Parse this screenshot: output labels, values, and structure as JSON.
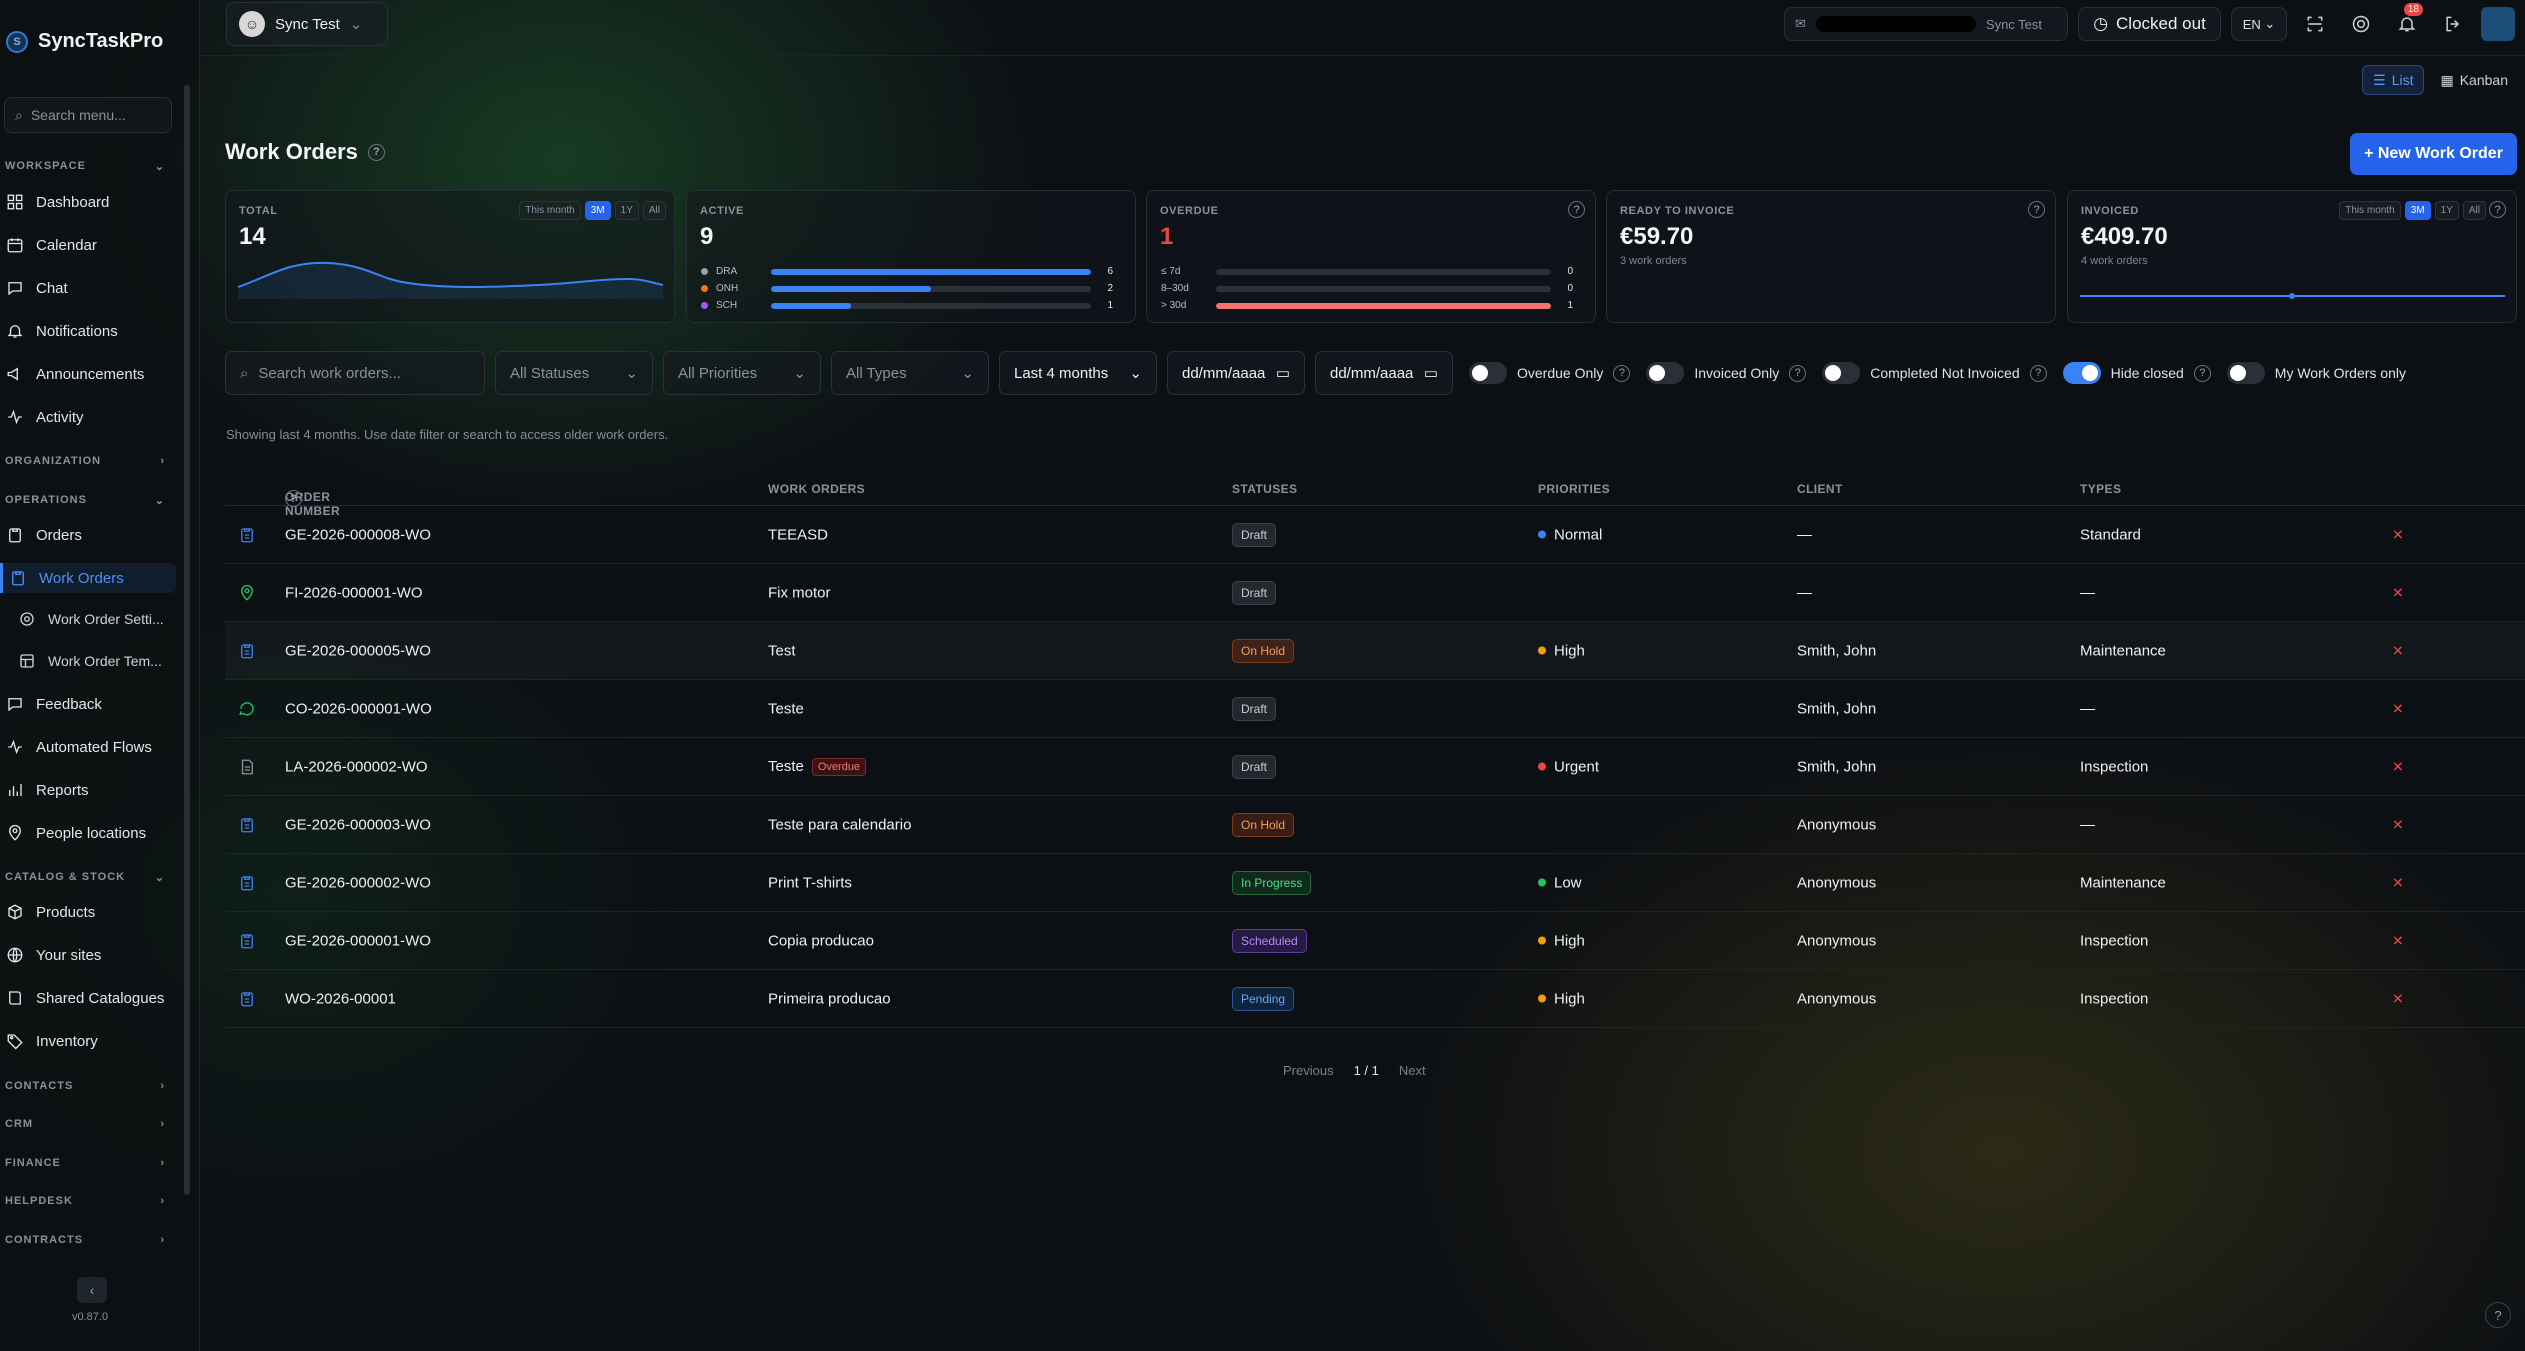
{
  "app": {
    "name": "SyncTaskPro",
    "version": "v0.87.0",
    "logo_letter": "S"
  },
  "sidebar": {
    "search_placeholder": "Search menu...",
    "sections": {
      "workspace": "WORKSPACE",
      "organization": "ORGANIZATION",
      "operations": "OPERATIONS",
      "catalog": "CATALOG & STOCK",
      "contacts": "CONTACTS",
      "crm": "CRM",
      "finance": "FINANCE",
      "helpdesk": "HELPDESK",
      "contracts": "CONTRACTS"
    },
    "items": {
      "dashboard": "Dashboard",
      "calendar": "Calendar",
      "chat": "Chat",
      "notifications": "Notifications",
      "announcements": "Announcements",
      "activity": "Activity",
      "orders": "Orders",
      "work_orders": "Work Orders",
      "wo_settings": "Work Order Setti...",
      "wo_templates": "Work Order Tem...",
      "feedback": "Feedback",
      "automated_flows": "Automated Flows",
      "reports": "Reports",
      "people_locations": "People locations",
      "products": "Products",
      "your_sites": "Your sites",
      "shared_catalogues": "Shared Catalogues",
      "inventory": "Inventory"
    }
  },
  "topbar": {
    "user": "Sync Test",
    "email_suffix": "Sync Test",
    "clock_status": "Clocked out",
    "language": "EN",
    "notification_count": "18"
  },
  "view": {
    "list": "List",
    "kanban": "Kanban",
    "active": "list"
  },
  "page": {
    "title": "Work Orders",
    "new_button": "+ New Work Order",
    "hint": "Showing last 4 months. Use date filter or search to access older work orders."
  },
  "cards": {
    "total": {
      "label": "TOTAL",
      "value": "14",
      "periods": [
        "This month",
        "3M",
        "1Y",
        "All"
      ],
      "active_period": "3M"
    },
    "active": {
      "label": "ACTIVE",
      "value": "9",
      "rows": [
        {
          "label": "DRA",
          "count": "6",
          "fraction": 1.0,
          "color": "#3b82f6",
          "dot": "#9aa1aa"
        },
        {
          "label": "ONH",
          "count": "2",
          "fraction": 0.5,
          "color": "#3b82f6",
          "dot": "#f97316"
        },
        {
          "label": "SCH",
          "count": "1",
          "fraction": 0.25,
          "color": "#3b82f6",
          "dot": "#a855f7"
        }
      ]
    },
    "overdue": {
      "label": "OVERDUE",
      "value": "1",
      "rows": [
        {
          "label": "≤ 7d",
          "count": "0",
          "fraction": 0
        },
        {
          "label": "8–30d",
          "count": "0",
          "fraction": 0
        },
        {
          "label": "> 30d",
          "count": "1",
          "fraction": 1.0
        }
      ]
    },
    "ready": {
      "label": "READY TO INVOICE",
      "value": "€59.70",
      "sub": "3 work orders"
    },
    "invoiced": {
      "label": "INVOICED",
      "value": "€409.70",
      "sub": "4 work orders",
      "periods": [
        "This month",
        "3M",
        "1Y",
        "All"
      ],
      "active_period": "3M"
    }
  },
  "filters": {
    "search_placeholder": "Search work orders...",
    "status": "All Statuses",
    "priority": "All Priorities",
    "type": "All Types",
    "range": "Last 4 months",
    "date_from": "dd/mm/aaaa",
    "date_to": "dd/mm/aaaa",
    "toggles": {
      "overdue": "Overdue Only",
      "invoiced": "Invoiced Only",
      "completed": "Completed Not Invoiced",
      "hide_closed": "Hide closed",
      "mine": "My Work Orders only"
    }
  },
  "table": {
    "headers": {
      "order": "ORDER NUMBER",
      "work": "WORK ORDERS",
      "status": "STATUSES",
      "priority": "PRIORITIES",
      "client": "CLIENT",
      "type": "TYPES"
    },
    "rows": [
      {
        "order": "GE-2026-000008-WO",
        "title": "TEEASD",
        "status": "Draft",
        "priority": "Normal",
        "priority_color": "#3b82f6",
        "client": "—",
        "type": "Standard",
        "icon": "clipboard-icon",
        "icon_color": "#3b82f6"
      },
      {
        "order": "FI-2026-000001-WO",
        "title": "Fix motor",
        "status": "Draft",
        "priority": "",
        "priority_color": "",
        "client": "—",
        "type": "—",
        "icon": "map-pin-icon",
        "icon_color": "#22c55e"
      },
      {
        "order": "GE-2026-000005-WO",
        "title": "Test",
        "status": "On Hold",
        "priority": "High",
        "priority_color": "#f59e0b",
        "client": "Smith, John",
        "type": "Maintenance",
        "icon": "clipboard-icon",
        "icon_color": "#3b82f6"
      },
      {
        "order": "CO-2026-000001-WO",
        "title": "Teste",
        "status": "Draft",
        "priority": "",
        "priority_color": "",
        "client": "Smith, John",
        "type": "—",
        "icon": "chat-icon",
        "icon_color": "#22c55e"
      },
      {
        "order": "LA-2026-000002-WO",
        "title": "Teste",
        "overdue": "Overdue",
        "status": "Draft",
        "priority": "Urgent",
        "priority_color": "#ef4444",
        "client": "Smith, John",
        "type": "Inspection",
        "icon": "document-icon",
        "icon_color": "#8a919a"
      },
      {
        "order": "GE-2026-000003-WO",
        "title": "Teste para calendario",
        "status": "On Hold",
        "priority": "",
        "priority_color": "",
        "client": "Anonymous",
        "type": "—",
        "icon": "clipboard-icon",
        "icon_color": "#3b82f6"
      },
      {
        "order": "GE-2026-000002-WO",
        "title": "Print T-shirts",
        "status": "In Progress",
        "priority": "Low",
        "priority_color": "#22c55e",
        "client": "Anonymous",
        "type": "Maintenance",
        "icon": "clipboard-icon",
        "icon_color": "#3b82f6"
      },
      {
        "order": "GE-2026-000001-WO",
        "title": "Copia producao",
        "status": "Scheduled",
        "priority": "High",
        "priority_color": "#f59e0b",
        "client": "Anonymous",
        "type": "Inspection",
        "icon": "clipboard-icon",
        "icon_color": "#3b82f6"
      },
      {
        "order": "WO-2026-00001",
        "title": "Primeira producao",
        "status": "Pending",
        "priority": "High",
        "priority_color": "#f59e0b",
        "client": "Anonymous",
        "type": "Inspection",
        "icon": "clipboard-icon",
        "icon_color": "#3b82f6"
      }
    ]
  },
  "pagination": {
    "previous": "Previous",
    "current": "1 / 1",
    "next": "Next"
  },
  "help": "?"
}
